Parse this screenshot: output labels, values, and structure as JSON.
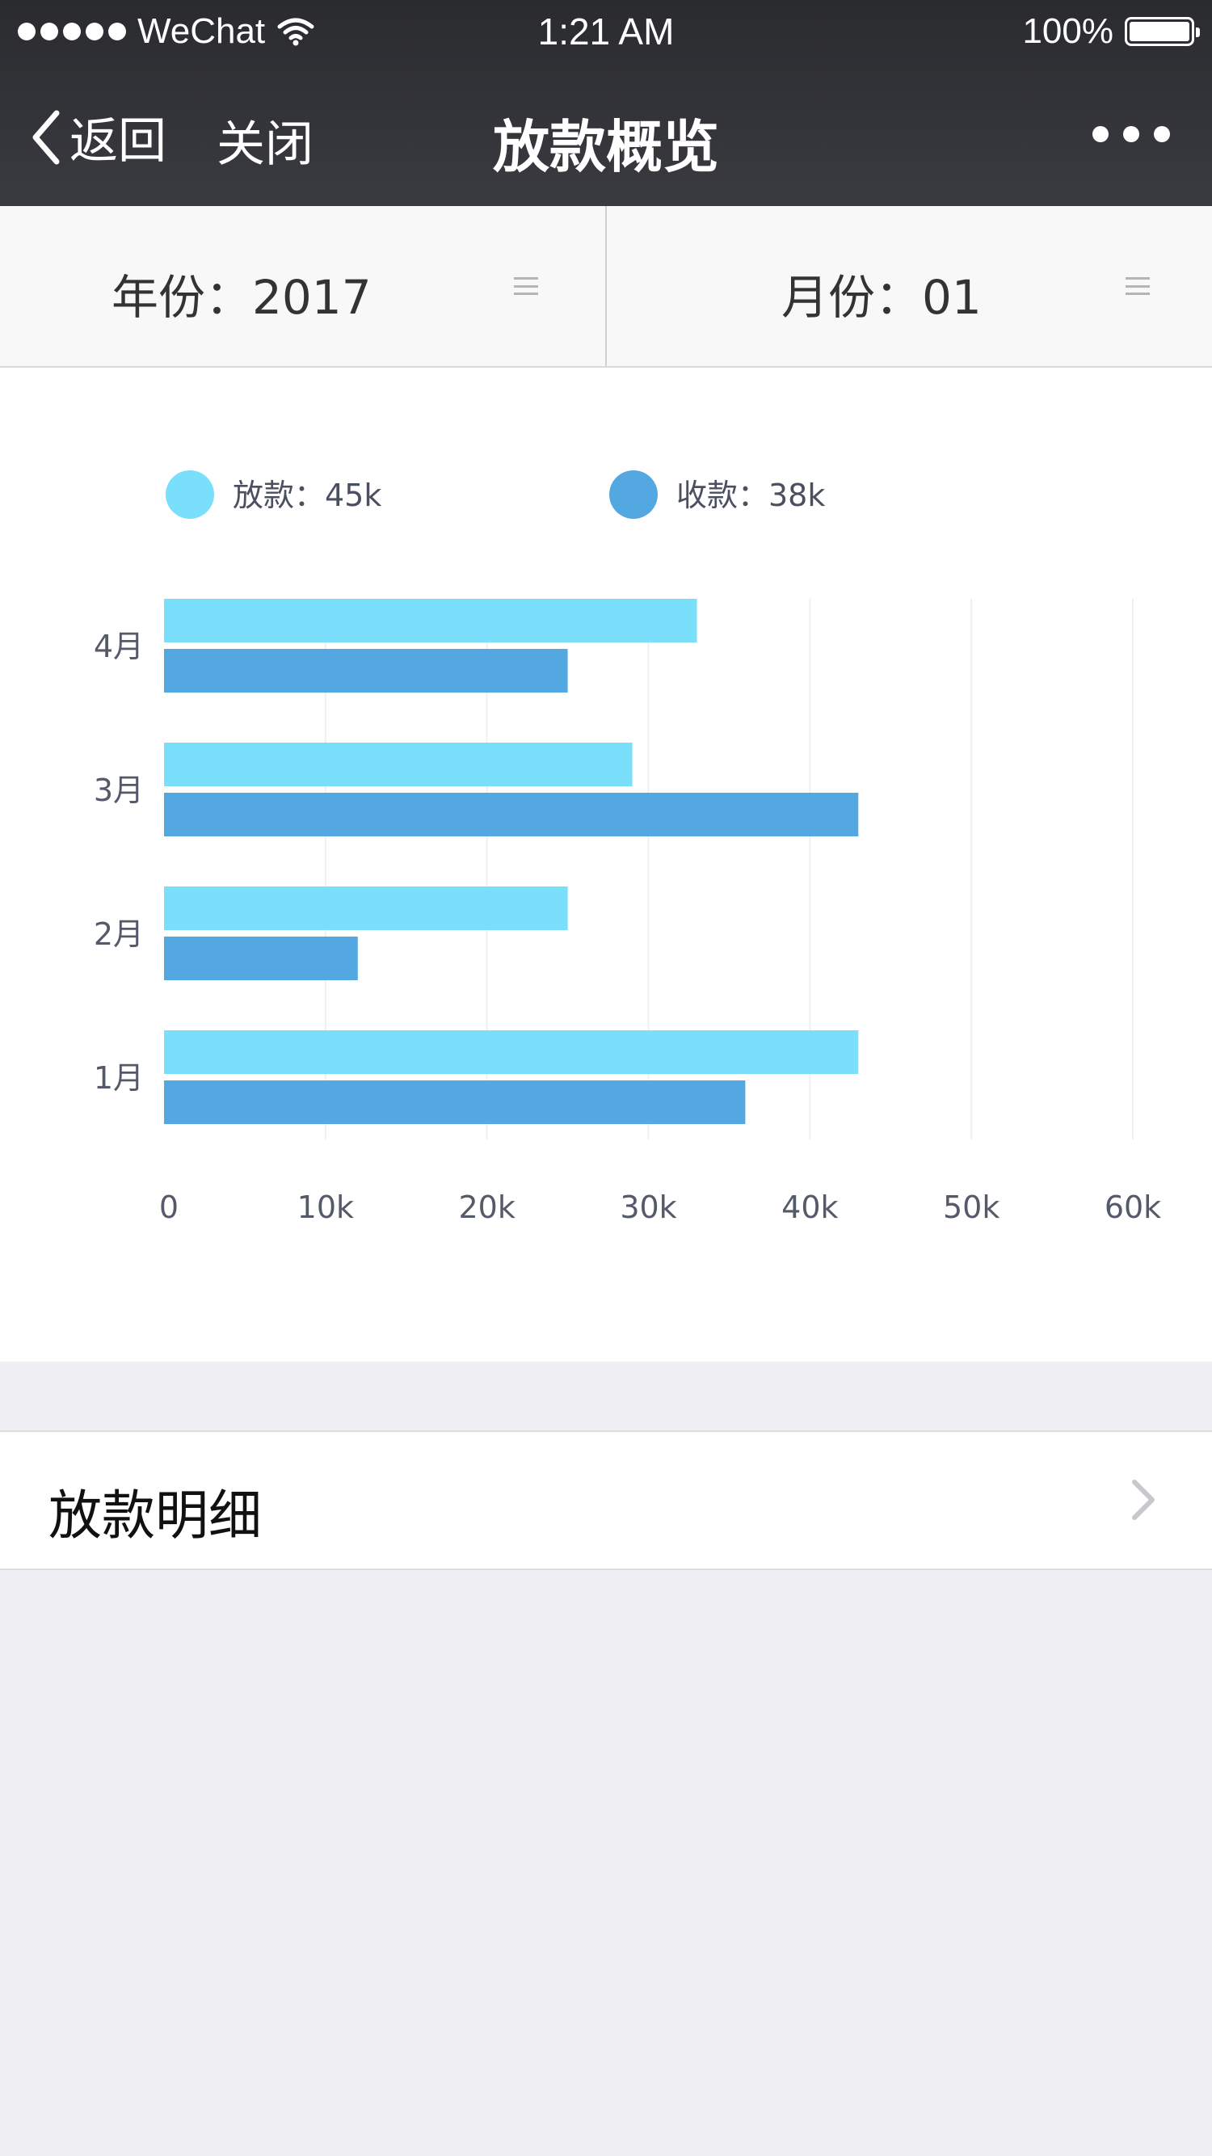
{
  "status_bar": {
    "carrier": "WeChat",
    "time": "1:21 AM",
    "battery": "100%"
  },
  "nav": {
    "back_label": "返回",
    "close_label": "关闭",
    "title": "放款概览"
  },
  "filters": {
    "year_text": "年份：2017",
    "month_text": "月份：01"
  },
  "legend": {
    "loan_label": "放款：45k",
    "collect_label": "收款：38k"
  },
  "colors": {
    "loan": "#79dffb",
    "collect": "#54a8e1"
  },
  "chart_data": {
    "type": "bar",
    "orientation": "horizontal",
    "categories": [
      "4月",
      "3月",
      "2月",
      "1月"
    ],
    "series": [
      {
        "name": "放款",
        "values": [
          33000,
          29000,
          25000,
          43000
        ]
      },
      {
        "name": "收款",
        "values": [
          25000,
          43000,
          12000,
          36000
        ]
      }
    ],
    "xlim": [
      0,
      60000
    ],
    "x_ticks": [
      0,
      10000,
      20000,
      30000,
      40000,
      50000,
      60000
    ],
    "x_tick_labels": [
      "0",
      "10k",
      "20k",
      "30k",
      "40k",
      "50k",
      "60k"
    ],
    "grid": true,
    "legend_position": "top"
  },
  "detail": {
    "label": "放款明细"
  }
}
